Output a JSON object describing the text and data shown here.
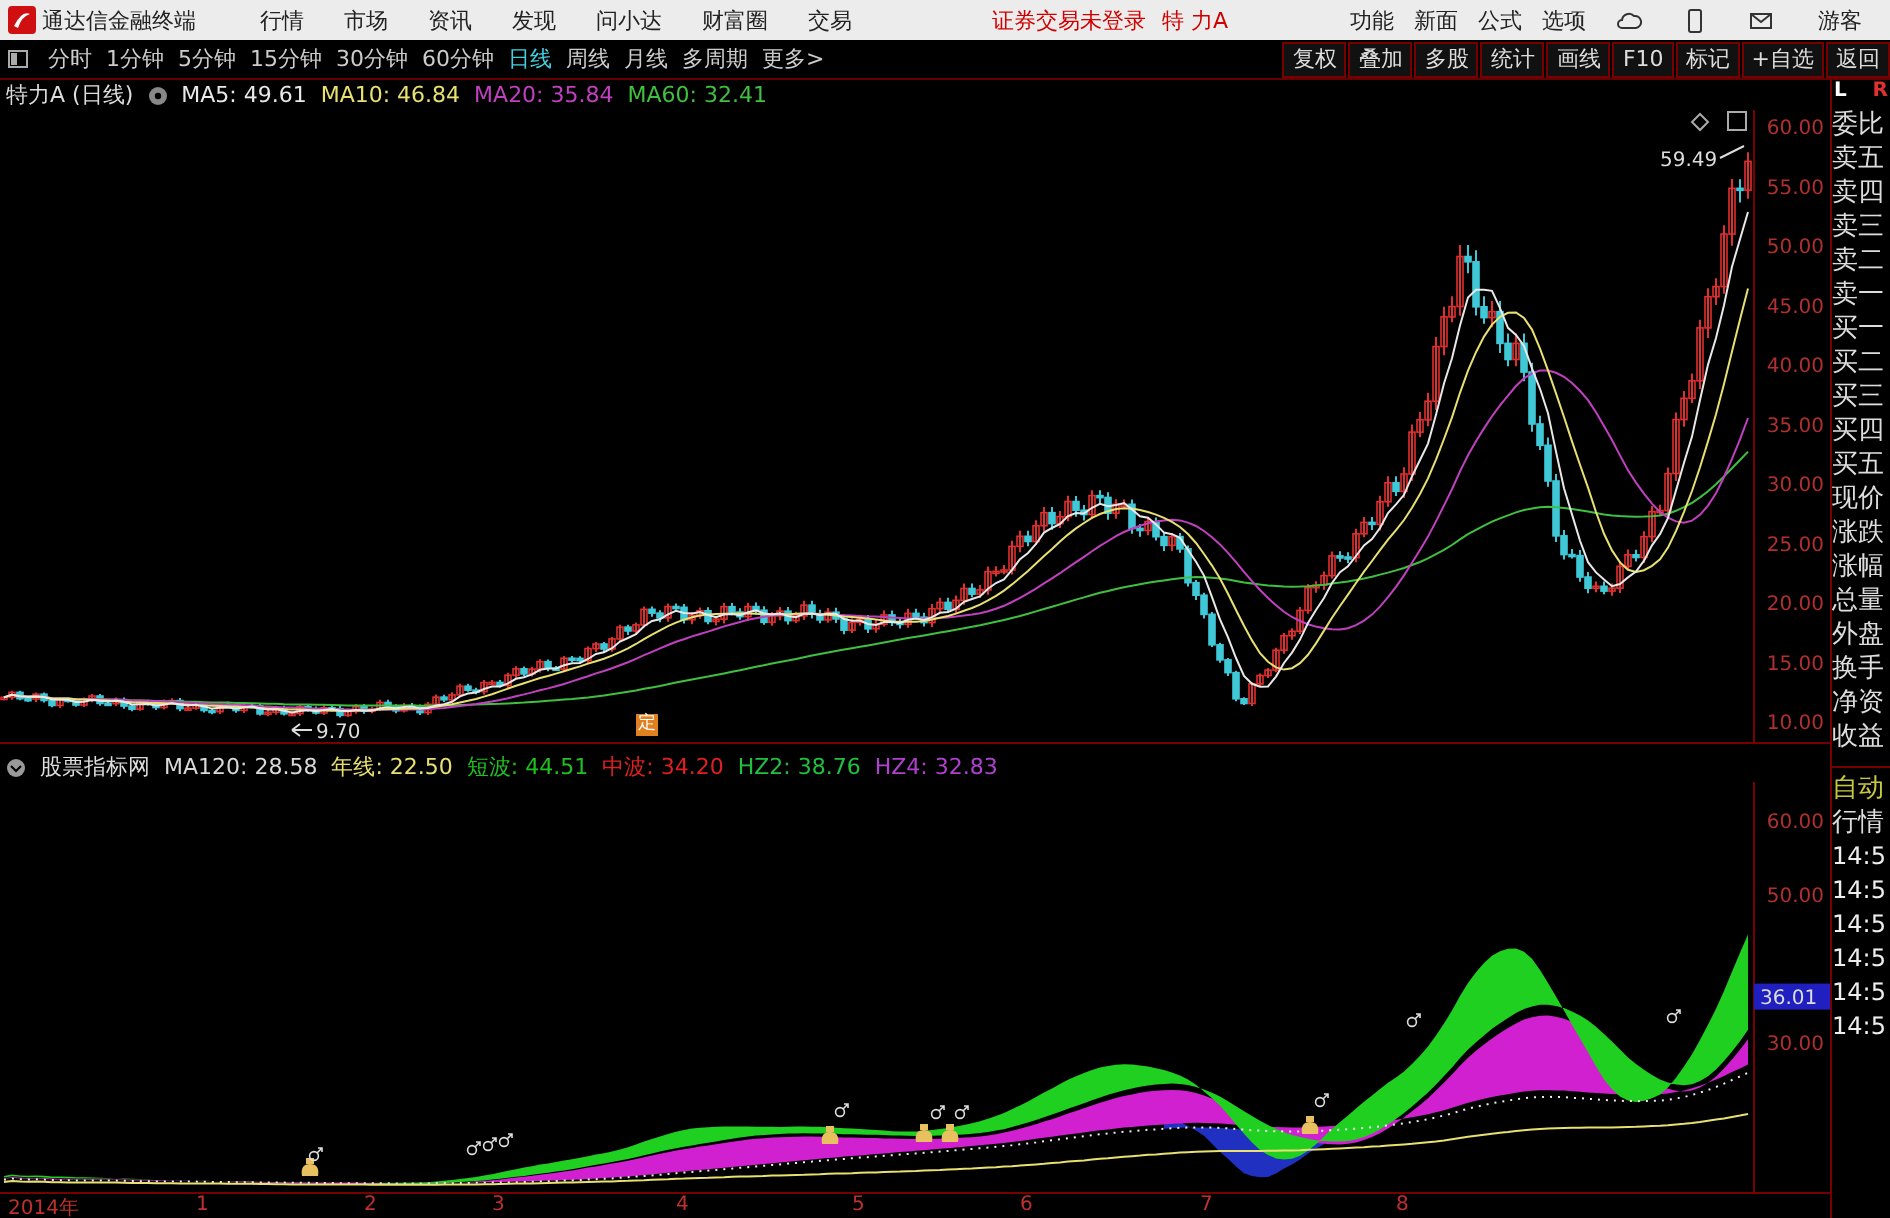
{
  "title_bar": {
    "app_name": "通达信金融终端",
    "menu": [
      "行情",
      "市场",
      "资讯",
      "发现",
      "问小达",
      "财富圈",
      "交易"
    ],
    "login_status": "证券交易未登录",
    "stock_name": "特 力A",
    "tools": [
      "功能",
      "新面",
      "公式",
      "选项"
    ],
    "user": "游客"
  },
  "toolbar": {
    "periods": [
      {
        "label": "分时",
        "selected": false
      },
      {
        "label": "1分钟",
        "selected": false
      },
      {
        "label": "5分钟",
        "selected": false
      },
      {
        "label": "15分钟",
        "selected": false
      },
      {
        "label": "30分钟",
        "selected": false
      },
      {
        "label": "60分钟",
        "selected": false
      },
      {
        "label": "日线",
        "selected": true
      },
      {
        "label": "周线",
        "selected": false
      },
      {
        "label": "月线",
        "selected": false
      },
      {
        "label": "多周期",
        "selected": false
      },
      {
        "label": "更多>",
        "selected": false
      }
    ],
    "actions": [
      "复权",
      "叠加",
      "多股",
      "统计",
      "画线",
      "F10",
      "标记",
      "+自选",
      "返回"
    ]
  },
  "main_chart": {
    "title": "特力A (日线)",
    "legend": [
      {
        "label": "MA5: 49.61",
        "color": "#e8e8e8"
      },
      {
        "label": "MA10: 46.84",
        "color": "#e8e070"
      },
      {
        "label": "MA20: 35.84",
        "color": "#c040c0"
      },
      {
        "label": "MA60: 32.41",
        "color": "#40c040"
      }
    ],
    "price_axis": [
      "60.00",
      "55.00",
      "50.00",
      "45.00",
      "40.00",
      "35.00",
      "30.00",
      "25.00",
      "20.00",
      "15.00",
      "10.00"
    ],
    "annotations": [
      {
        "kind": "high",
        "text": "59.49"
      },
      {
        "kind": "low",
        "text": "9.70"
      }
    ],
    "event_marker": "定"
  },
  "indicator": {
    "title": "股票指标网",
    "legend": [
      {
        "label": "MA120: 28.58",
        "color": "#d8d8d8"
      },
      {
        "label": "年线: 22.50",
        "color": "#e8e070"
      },
      {
        "label": "短波: 44.51",
        "color": "#20c020"
      },
      {
        "label": "中波: 34.20",
        "color": "#e02020"
      },
      {
        "label": "HZ2: 38.76",
        "color": "#20c040"
      },
      {
        "label": "HZ4: 32.83",
        "color": "#b040d0"
      }
    ],
    "axis": [
      "60.00",
      "50.00",
      "30.00"
    ],
    "current_value": "36.01"
  },
  "date_axis": [
    "2014年",
    "1",
    "2",
    "3",
    "4",
    "5",
    "6",
    "7",
    "8"
  ],
  "side_panel": {
    "corner": [
      "L",
      "R"
    ],
    "quote_labels": [
      "委比",
      "卖五",
      "卖四",
      "卖三",
      "卖二",
      "卖一",
      "买一",
      "买二",
      "买三",
      "买四",
      "买五",
      "现价",
      "涨跌",
      "涨幅",
      "总量",
      "外盘",
      "换手",
      "净资",
      "收益"
    ],
    "tabs": [
      "自动",
      "行情"
    ],
    "ticks": [
      "14:5",
      "14:5",
      "14:5",
      "14:5",
      "14:5",
      "14:5"
    ]
  }
}
